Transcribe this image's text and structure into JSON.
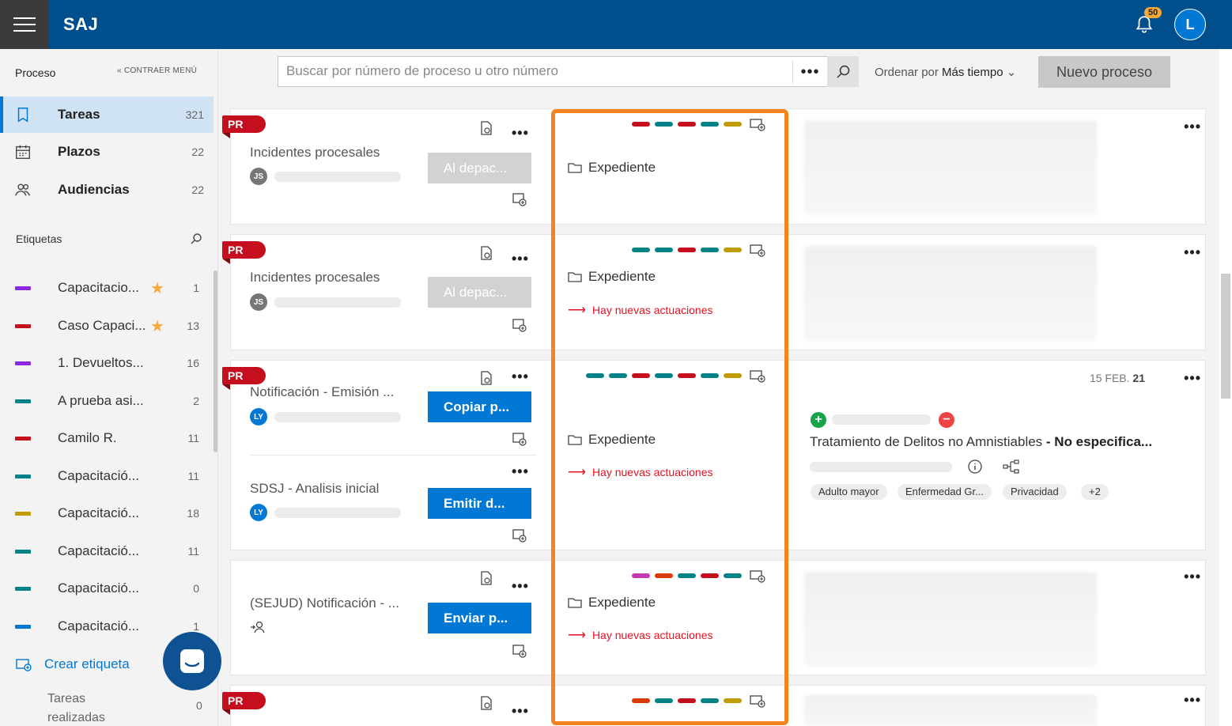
{
  "app": {
    "title": "SAJ",
    "notification_count": "50",
    "user_initial": "L"
  },
  "sidebar": {
    "heading": "Proceso",
    "collapse_label": "CONTRAER MENÚ",
    "nav": [
      {
        "label": "Tareas",
        "count": "321",
        "icon": "bookmark-icon"
      },
      {
        "label": "Plazos",
        "count": "22",
        "icon": "calendar-icon"
      },
      {
        "label": "Audiencias",
        "count": "22",
        "icon": "people-icon"
      }
    ],
    "tags_heading": "Etiquetas",
    "tags": [
      {
        "label": "Capacitacio...",
        "count": "1",
        "color": "#8a2be2",
        "star": true
      },
      {
        "label": "Caso Capaci...",
        "count": "13",
        "color": "#c50f1f",
        "star": true
      },
      {
        "label": "1. Devueltos...",
        "count": "16",
        "color": "#8a2be2",
        "star": false
      },
      {
        "label": "A prueba asi...",
        "count": "2",
        "color": "#038387",
        "star": false
      },
      {
        "label": "Camilo R.",
        "count": "11",
        "color": "#c50f1f",
        "star": false
      },
      {
        "label": "Capacitació...",
        "count": "11",
        "color": "#038387",
        "star": false
      },
      {
        "label": "Capacitació...",
        "count": "18",
        "color": "#c19c00",
        "star": false
      },
      {
        "label": "Capacitació...",
        "count": "11",
        "color": "#038387",
        "star": false
      },
      {
        "label": "Capacitació...",
        "count": "0",
        "color": "#038387",
        "star": false
      },
      {
        "label": "Capacitació...",
        "count": "1",
        "color": "#0078d4",
        "star": false
      }
    ],
    "create_tag": "Crear etiqueta",
    "done_label": "Tareas realizadas",
    "done_count": "0"
  },
  "toolbar": {
    "search_placeholder": "Buscar por número de proceso u otro número",
    "more": "•••",
    "sort_prefix": "Ordenar por",
    "sort_value": "Más tiempo",
    "new_process": "Nuevo proceso"
  },
  "cards": [
    {
      "badge": "PR",
      "task": "Incidentes procesales",
      "initials": "JS",
      "action": "Al depac...",
      "expediente": "Expediente",
      "news": "",
      "swatches": [
        "#c50f1f",
        "#038387",
        "#c50f1f",
        "#038387",
        "#c19c00"
      ]
    },
    {
      "badge": "PR",
      "task": "Incidentes procesales",
      "initials": "JS",
      "action": "Al depac...",
      "expediente": "Expediente",
      "news": "Hay nuevas actuaciones",
      "swatches": [
        "#038387",
        "#038387",
        "#c50f1f",
        "#038387",
        "#c19c00"
      ]
    },
    {
      "badge": "PR",
      "task": "Notificación - Emisión ...",
      "initials": "LY",
      "action": "Copiar p...",
      "task2": "SDSJ - Analisis inicial",
      "initials2": "LY",
      "action2": "Emitir d...",
      "expediente": "Expediente",
      "news": "Hay nuevas actuaciones",
      "swatches": [
        "#038387",
        "#038387",
        "#c50f1f",
        "#038387",
        "#c50f1f",
        "#038387",
        "#c19c00"
      ],
      "date_day": "15 FEB.",
      "date_year": "21",
      "case_name": "Tratamiento de Delitos no Amnistiables",
      "case_sep": " - ",
      "case_status": "No especifica...",
      "chips": [
        "Adulto mayor",
        "Enfermedad Gr...",
        "Privacidad",
        "+2"
      ]
    },
    {
      "badge": "",
      "task": "(SEJUD) Notificación - ...",
      "action": "Enviar p...",
      "expediente": "Expediente",
      "news": "Hay nuevas actuaciones",
      "swatches": [
        "#c239b3",
        "#da3b01",
        "#038387",
        "#c50f1f",
        "#038387"
      ]
    },
    {
      "badge": "PR",
      "swatches": [
        "#da3b01",
        "#038387",
        "#c50f1f",
        "#038387",
        "#c19c00"
      ]
    }
  ]
}
